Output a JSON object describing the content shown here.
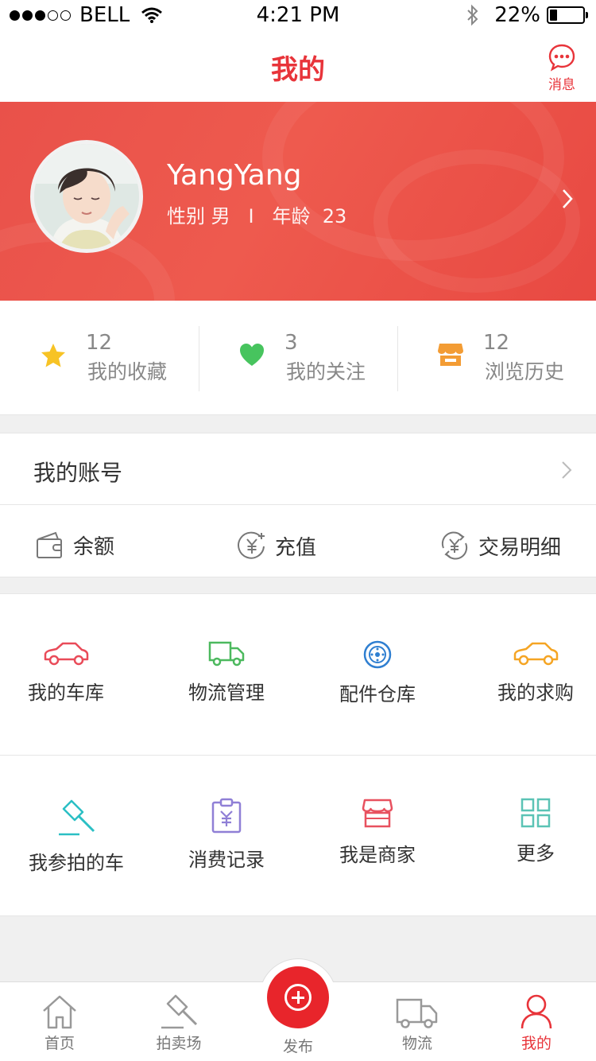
{
  "status_bar": {
    "carrier": "BELL",
    "time": "4:21 PM",
    "battery": "22%",
    "battery_level": 0.22,
    "icons": [
      "signal-dots",
      "wifi-icon",
      "bluetooth-icon",
      "battery-icon"
    ]
  },
  "nav": {
    "title": "我的",
    "message_label": "消息"
  },
  "profile": {
    "name": "YangYang",
    "gender_label": "性别",
    "gender": "男",
    "separator": "I",
    "age_label": "年龄",
    "age": "23"
  },
  "stats": [
    {
      "count": "12",
      "label": "我的收藏",
      "icon": "star-icon",
      "color": "#f7c325"
    },
    {
      "count": "3",
      "label": "我的关注",
      "icon": "heart-icon",
      "color": "#47c45e"
    },
    {
      "count": "12",
      "label": "浏览历史",
      "icon": "shop-icon",
      "color": "#f39c34"
    }
  ],
  "account": {
    "title": "我的账号",
    "items": [
      {
        "label": "余额",
        "icon": "wallet-icon"
      },
      {
        "label": "充值",
        "icon": "yen-plus-icon"
      },
      {
        "label": "交易明细",
        "icon": "yen-cycle-icon"
      }
    ]
  },
  "grid": [
    {
      "label": "我的车库",
      "icon": "car-icon",
      "color": "#e94b59"
    },
    {
      "label": "物流管理",
      "icon": "truck-icon",
      "color": "#4cb95e"
    },
    {
      "label": "配件仓库",
      "icon": "wheel-icon",
      "color": "#2f7fd1"
    },
    {
      "label": "我的求购",
      "icon": "car-icon",
      "color": "#f5a524"
    },
    {
      "label": "我参拍的车",
      "icon": "gavel-icon",
      "color": "#2bbfc4"
    },
    {
      "label": "消费记录",
      "icon": "receipt-icon",
      "color": "#8f7fd6"
    },
    {
      "label": "我是商家",
      "icon": "store-icon",
      "color": "#e8515f"
    },
    {
      "label": "更多",
      "icon": "grid-icon",
      "color": "#5bc3b5"
    }
  ],
  "tabs": [
    {
      "label": "首页",
      "icon": "home-icon"
    },
    {
      "label": "拍卖场",
      "icon": "gavel-icon"
    },
    {
      "label": "发布",
      "icon": "plus-icon"
    },
    {
      "label": "物流",
      "icon": "truck-icon"
    },
    {
      "label": "我的",
      "icon": "person-icon",
      "active": true
    }
  ],
  "colors": {
    "accent": "#e8343a",
    "banner": "#ec524a",
    "tab_inactive": "#777777"
  }
}
